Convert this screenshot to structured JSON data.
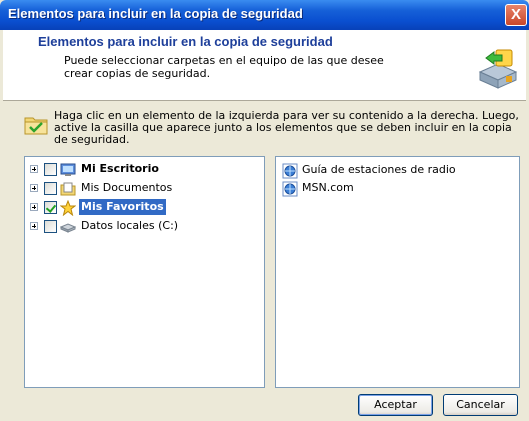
{
  "window": {
    "title": "Elementos para incluir en la copia de seguridad",
    "close_glyph": "X"
  },
  "header": {
    "title": "Elementos para incluir en la copia de seguridad",
    "description": "Puede seleccionar carpetas en el equipo de las que desee crear copias de seguridad.",
    "icon": "backup-drive-icon"
  },
  "instructions": {
    "icon": "folder-check-icon",
    "text": "Haga clic en un elemento de la izquierda para ver su contenido a la derecha. Luego, active la casilla que aparece junto a los elementos que se deben incluir en la copia de seguridad."
  },
  "tree": {
    "items": [
      {
        "label": "Mi Escritorio",
        "icon": "desktop-icon",
        "checked": false,
        "bold": true,
        "selected": false
      },
      {
        "label": "Mis Documentos",
        "icon": "documents-folder-icon",
        "checked": false,
        "bold": false,
        "selected": false
      },
      {
        "label": "Mis Favoritos",
        "icon": "favorites-star-icon",
        "checked": true,
        "bold": true,
        "selected": true
      },
      {
        "label": "Datos locales (C:)",
        "icon": "local-disk-icon",
        "checked": false,
        "bold": false,
        "selected": false
      }
    ]
  },
  "contents": {
    "items": [
      {
        "label": "Guía de estaciones de radio",
        "icon": "internet-shortcut-icon"
      },
      {
        "label": "MSN.com",
        "icon": "internet-shortcut-icon"
      }
    ]
  },
  "buttons": {
    "ok_label": "Aceptar",
    "cancel_label": "Cancelar"
  },
  "colors": {
    "title_bar": "#0a4fd0",
    "header_title": "#1e3f9a",
    "selection": "#316ac5",
    "window_bg": "#ece9d8"
  }
}
